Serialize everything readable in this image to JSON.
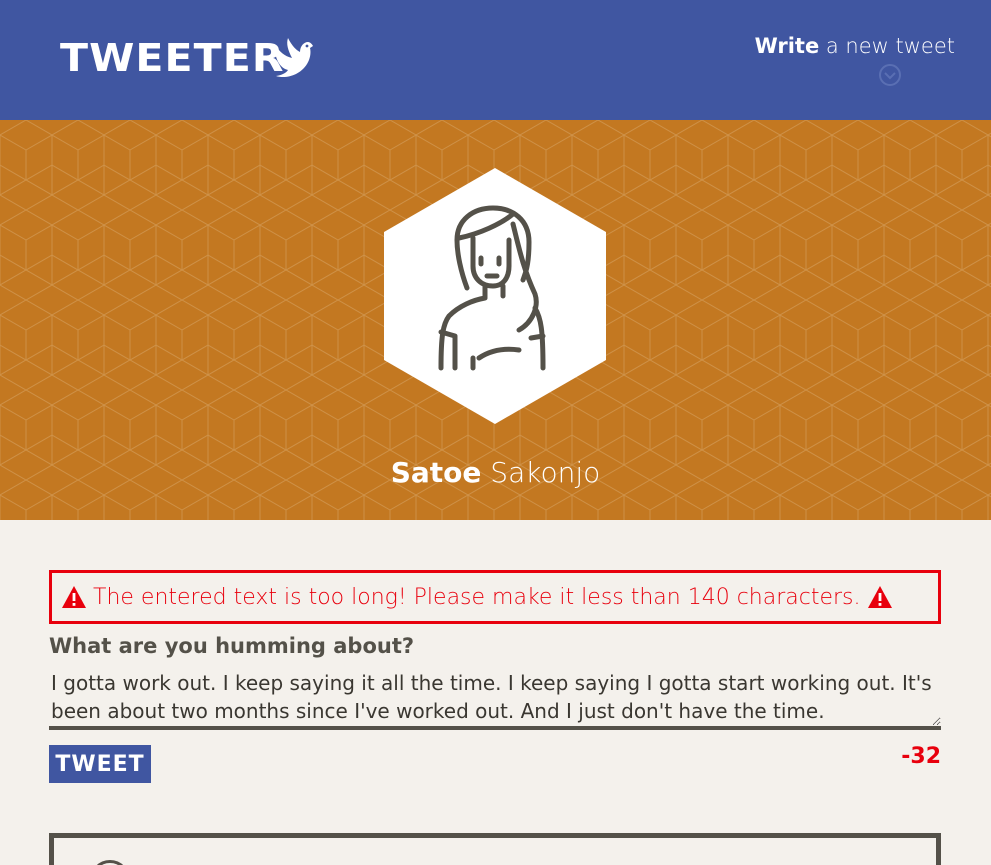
{
  "nav": {
    "logo_text": "TWEETER",
    "compose_bold": "Write",
    "compose_rest": " a new tweet",
    "compose_icon": "chevron-down-icon"
  },
  "profile": {
    "first_name": "Satoe",
    "last_name": " Sakonjo",
    "avatar_icon": "woman-avatar-icon"
  },
  "composer": {
    "error_message": "The entered text is too long! Please make it less than 140 characters.",
    "label": "What are you humming about?",
    "text": "I gotta work out. I keep saying it all the time. I keep saying I gotta start working out. It's been about two months since I've worked out. And I just don't have the time.",
    "button_label": "TWEET",
    "counter": "-32"
  },
  "colors": {
    "nav_bg": "#4056a1",
    "header_bg": "#c37821",
    "page_bg": "#f4f1ec",
    "error": "#e8000d",
    "text": "#545149"
  }
}
